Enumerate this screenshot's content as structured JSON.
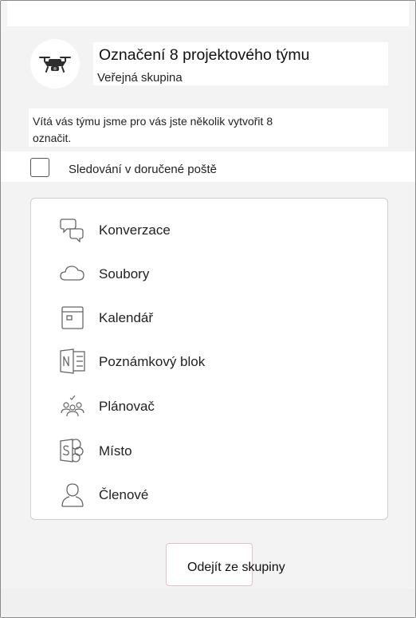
{
  "group": {
    "name": "Označení 8 projektového týmu",
    "type": "Veřejná skupina",
    "description": "Vítá vás týmu jsme pro vás jste několik vytvořit 8 označit."
  },
  "follow": {
    "label": "Sledování v doručené poště",
    "checked": false
  },
  "apps": [
    {
      "label": "Konverzace",
      "icon": "conversation-icon"
    },
    {
      "label": "Soubory",
      "icon": "cloud-icon"
    },
    {
      "label": "Kalendář",
      "icon": "calendar-icon"
    },
    {
      "label": "Poznámkový blok",
      "icon": "onenote-icon"
    },
    {
      "label": "Plánovač",
      "icon": "planner-icon"
    },
    {
      "label": "Místo",
      "icon": "sharepoint-icon"
    },
    {
      "label": "Členové",
      "icon": "person-icon"
    }
  ],
  "actions": {
    "leave_label": "Odejít ze skupiny"
  }
}
